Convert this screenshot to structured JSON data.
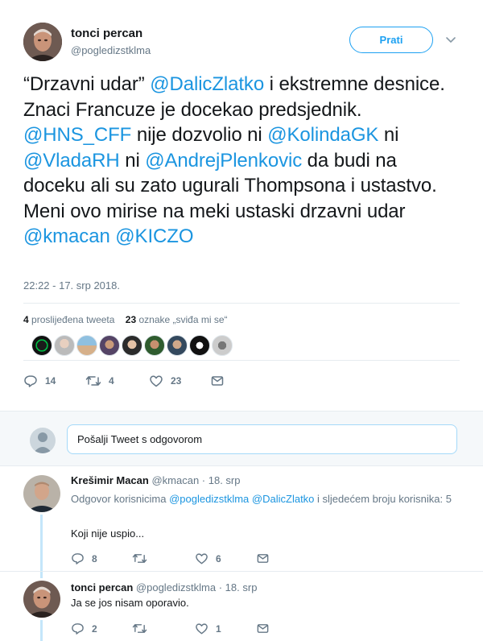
{
  "tweet": {
    "author_name": "tonci percan",
    "author_handle": "@pogledizstklma",
    "follow_label": "Prati",
    "text_parts": [
      {
        "t": "“Drzavni udar” ",
        "link": false
      },
      {
        "t": "@DalicZlatko",
        "link": true
      },
      {
        "t": " i ekstremne desnice. Znaci Francuze je docekao predsjednik. ",
        "link": false
      },
      {
        "t": "@HNS_CFF",
        "link": true
      },
      {
        "t": " nije dozvolio ni ",
        "link": false
      },
      {
        "t": "@KolindaGK",
        "link": true
      },
      {
        "t": " ni ",
        "link": false
      },
      {
        "t": "@VladaRH",
        "link": true
      },
      {
        "t": " ni ",
        "link": false
      },
      {
        "t": "@AndrejPlenkovic",
        "link": true
      },
      {
        "t": " da budi na doceku ali su zato ugurali Thompsona i ustastvo. Meni ovo mirise na meki ustaski drzavni udar ",
        "link": false
      },
      {
        "t": "@kmacan",
        "link": true
      },
      {
        "t": " ",
        "link": false
      },
      {
        "t": "@KICZO",
        "link": true
      }
    ],
    "timestamp": "22:22 - 17. srp 2018.",
    "retweets_count": "4",
    "retweets_label": "proslijeđena tweeta",
    "likes_count": "23",
    "likes_label": "oznake „sviđa mi se“",
    "actions": {
      "replies": "14",
      "retweets": "4",
      "likes": "23"
    }
  },
  "reply_box": {
    "placeholder": "Pošalji Tweet s odgovorom"
  },
  "replies": [
    {
      "name": "Krešimir Macan",
      "handle": "@kmacan",
      "date": "· 18. srp",
      "context_prefix": "Odgovor korisnicima ",
      "context_mention_1": "@pogledizstklma",
      "context_mention_2": "@DalicZlatko",
      "context_suffix": " i sljedećem broju korisnika: 5",
      "text": "Koji nije uspio...",
      "actions": {
        "replies": "8",
        "retweets": "",
        "likes": "6"
      }
    },
    {
      "name": "tonci percan",
      "handle": "@pogledizstklma",
      "date": "· 18. srp",
      "text": "Ja se jos nisam oporavio.",
      "actions": {
        "replies": "2",
        "retweets": "",
        "likes": "1"
      }
    }
  ],
  "colors": {
    "accent": "#1da1f2",
    "link": "#1b95e0",
    "muted": "#657786",
    "thread": "#c4e6fa"
  },
  "icons": [
    "caret-down-icon",
    "reply-icon",
    "retweet-icon",
    "heart-icon",
    "message-icon"
  ]
}
